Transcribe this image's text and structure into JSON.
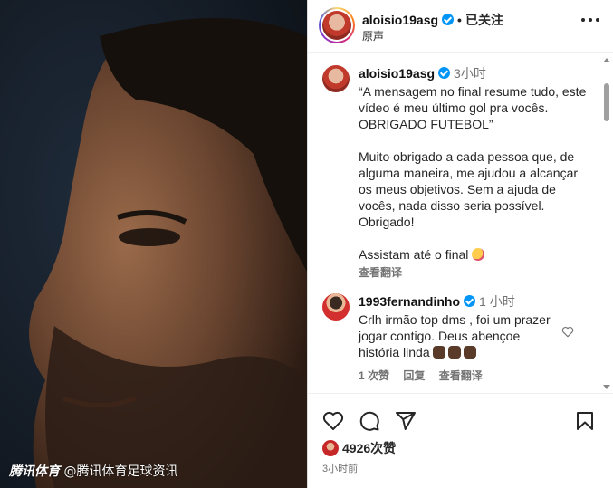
{
  "header": {
    "username": "aloisio19asg",
    "follow_state": "已关注",
    "separator": "•",
    "subtitle": "原声"
  },
  "caption": {
    "username": "aloisio19asg",
    "time": "3小时",
    "paragraphs": [
      "“A mensagem no final resume tudo, este vídeo é meu último gol pra vocês. OBRIGADO FUTEBOL”",
      "Muito obrigado a cada pessoa que, de alguma maneira, me ajudou a alcançar os meus objetivos. Sem a ajuda de vocês, nada disso seria possível. Obrigado!",
      "Assistam até o final"
    ],
    "translate": "查看翻译"
  },
  "comment": {
    "username": "1993fernandinho",
    "time": "1 小时",
    "text": "Crlh irmão top dms , foi um prazer jogar contigo. Deus abençoe história linda",
    "likes": "1 次赞",
    "reply": "回复",
    "translate": "查看翻译"
  },
  "actions": {
    "likes": "4926次赞",
    "posted": "3小时前"
  },
  "watermark": {
    "brand": "腾讯体育",
    "handle": "@腾讯体育足球资讯"
  },
  "colors": {
    "verified": "#0095f6",
    "muted": "#737373",
    "text": "#262626"
  }
}
